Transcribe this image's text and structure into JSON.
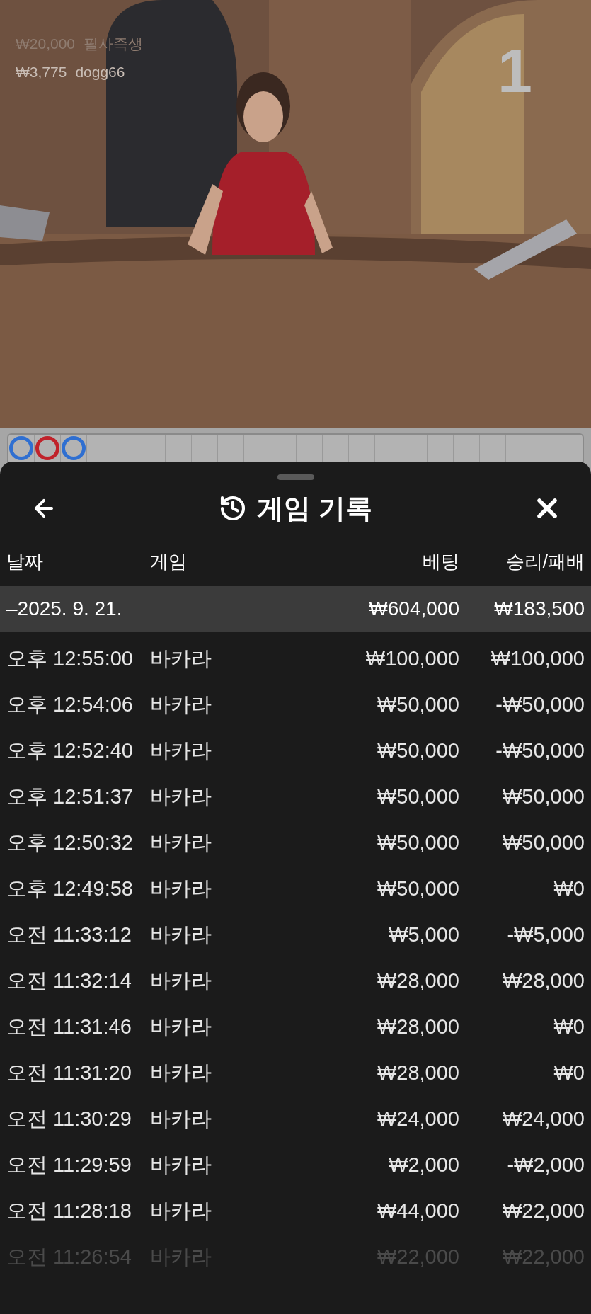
{
  "video": {
    "overlay": [
      {
        "amount": "₩20,000",
        "name": "필사즉생",
        "dim": true
      },
      {
        "amount": "₩3,775",
        "name": "dogg66",
        "dim": false
      }
    ],
    "counter": "1"
  },
  "road": {
    "marks": [
      {
        "color": "#2f6fd1"
      },
      {
        "color": "#c0232b"
      },
      {
        "color": "#2f6fd1"
      }
    ]
  },
  "sheet": {
    "title": "게임 기록",
    "columns": [
      "날짜",
      "게임",
      "베팅",
      "승리/패배"
    ],
    "group": {
      "date": "–2025. 9. 21.",
      "bet": "₩604,000",
      "result": "₩183,500"
    },
    "rows": [
      {
        "time": "오후 12:55:00",
        "game": "바카라",
        "bet": "₩100,000",
        "result": "₩100,000",
        "faded": false
      },
      {
        "time": "오후 12:54:06",
        "game": "바카라",
        "bet": "₩50,000",
        "result": "-₩50,000",
        "faded": false
      },
      {
        "time": "오후 12:52:40",
        "game": "바카라",
        "bet": "₩50,000",
        "result": "-₩50,000",
        "faded": false
      },
      {
        "time": "오후 12:51:37",
        "game": "바카라",
        "bet": "₩50,000",
        "result": "₩50,000",
        "faded": false
      },
      {
        "time": "오후 12:50:32",
        "game": "바카라",
        "bet": "₩50,000",
        "result": "₩50,000",
        "faded": false
      },
      {
        "time": "오후 12:49:58",
        "game": "바카라",
        "bet": "₩50,000",
        "result": "₩0",
        "faded": false
      },
      {
        "time": "오전 11:33:12",
        "game": "바카라",
        "bet": "₩5,000",
        "result": "-₩5,000",
        "faded": false
      },
      {
        "time": "오전 11:32:14",
        "game": "바카라",
        "bet": "₩28,000",
        "result": "₩28,000",
        "faded": false
      },
      {
        "time": "오전 11:31:46",
        "game": "바카라",
        "bet": "₩28,000",
        "result": "₩0",
        "faded": false
      },
      {
        "time": "오전 11:31:20",
        "game": "바카라",
        "bet": "₩28,000",
        "result": "₩0",
        "faded": false
      },
      {
        "time": "오전 11:30:29",
        "game": "바카라",
        "bet": "₩24,000",
        "result": "₩24,000",
        "faded": false
      },
      {
        "time": "오전 11:29:59",
        "game": "바카라",
        "bet": "₩2,000",
        "result": "-₩2,000",
        "faded": false
      },
      {
        "time": "오전 11:28:18",
        "game": "바카라",
        "bet": "₩44,000",
        "result": "₩22,000",
        "faded": false
      },
      {
        "time": "오전 11:26:54",
        "game": "바카라",
        "bet": "₩22,000",
        "result": "₩22,000",
        "faded": true
      }
    ]
  }
}
